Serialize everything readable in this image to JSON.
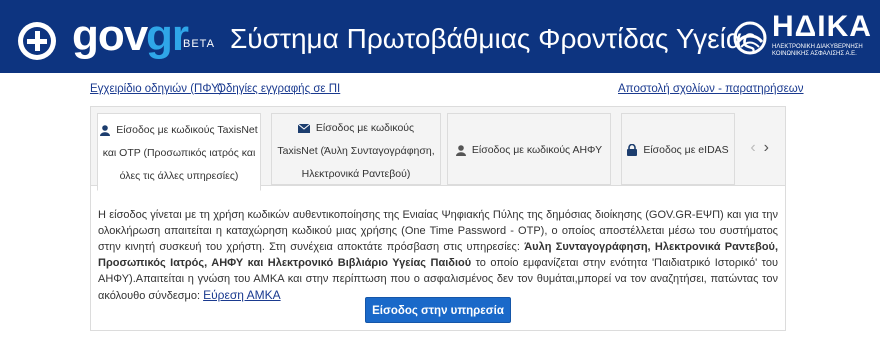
{
  "header": {
    "logo_gov": "gov",
    "logo_gr": "gr",
    "logo_beta": "BETA",
    "title": "Σύστημα Πρωτοβάθμιας Φροντίδας Υγείας",
    "org_name": "ΗΔΙΚΑ",
    "org_subtitle": "ΗΛΕΚΤΡΟΝΙΚΗ ΔΙΑΚΥΒΕΡΝΗΣΗ ΚΟΙΝΩΝΙΚΗΣ ΑΣΦΑΛΙΣΗΣ Α.Ε.",
    "colors": {
      "background": "#0d3480",
      "accent": "#2fa6e8"
    }
  },
  "top_links": {
    "manual": "Εγχειρίδιο οδηγιών (ΠΦΥ)",
    "registration": "Οδηγίες εγγραφής σε ΠΙ",
    "feedback": "Αποστολή σχολίων - παρατηρήσεων"
  },
  "tabs": [
    {
      "icon": "user-icon",
      "line1": "Είσοδος με κωδικούς TaxisNet",
      "line2": "και OTP (Προσωπικός ιατρός και",
      "line3": "όλες τις άλλες υπηρεσίες)",
      "active": true
    },
    {
      "icon": "envelope-icon",
      "line1": "Είσοδος με κωδικούς",
      "line2": "TaxisNet (Άυλη Συνταγογράφηση,",
      "line3": "Ηλεκτρονικά Ραντεβού)",
      "active": false
    },
    {
      "icon": "user-icon",
      "line1": "Είσοδος με κωδικούς ΑΗΦΥ",
      "active": false
    },
    {
      "icon": "lock-icon",
      "line1": "Είσοδος με eIDAS",
      "active": false
    }
  ],
  "tab_nav": {
    "prev": "‹",
    "next": "›"
  },
  "content": {
    "p1": "Η είσοδος γίνεται με τη χρήση κωδικών αυθεντικοποίησης της Ενιαίας Ψηφιακής Πύλης της δημόσιας διοίκησης (GOV.GR-ΕΨΠ) και για την ολοκλήρωση απαιτείται η καταχώρηση κωδικού μιας χρήσης (One Time Password - OTP), ο οποίος αποστέλλεται μέσω του συστήματος στην κινητή συσκευή του χρήστη. Στη συνέχεια αποκτάτε πρόσβαση στις υπηρεσίες: ",
    "p1_bold1": "Άυλη Συνταγογράφηση, Ηλεκτρονικά Ραντεβού, Προσωπικός Ιατρός, ΑΗΦΥ και Ηλεκτρονικό Βιβλιάριο Υγείας Παιδιού",
    "p1_mid": " το οποίο εμφανίζεται στην ενότητα 'Παιδιατρικό Ιστορικό' του ΑΗΦΥ).",
    "p1_tail": "Απαιτείται η γνώση του ΑΜΚΑ και στην περίπτωση που ο ασφαλισμένος δεν τον θυμάται,μπορεί να τον αναζητήσει, πατώντας τον ακόλουθο σύνδεσμο: ",
    "amka_link": "Εύρεση ΑΜΚΑ",
    "button": "Είσοδος στην υπηρεσία"
  }
}
